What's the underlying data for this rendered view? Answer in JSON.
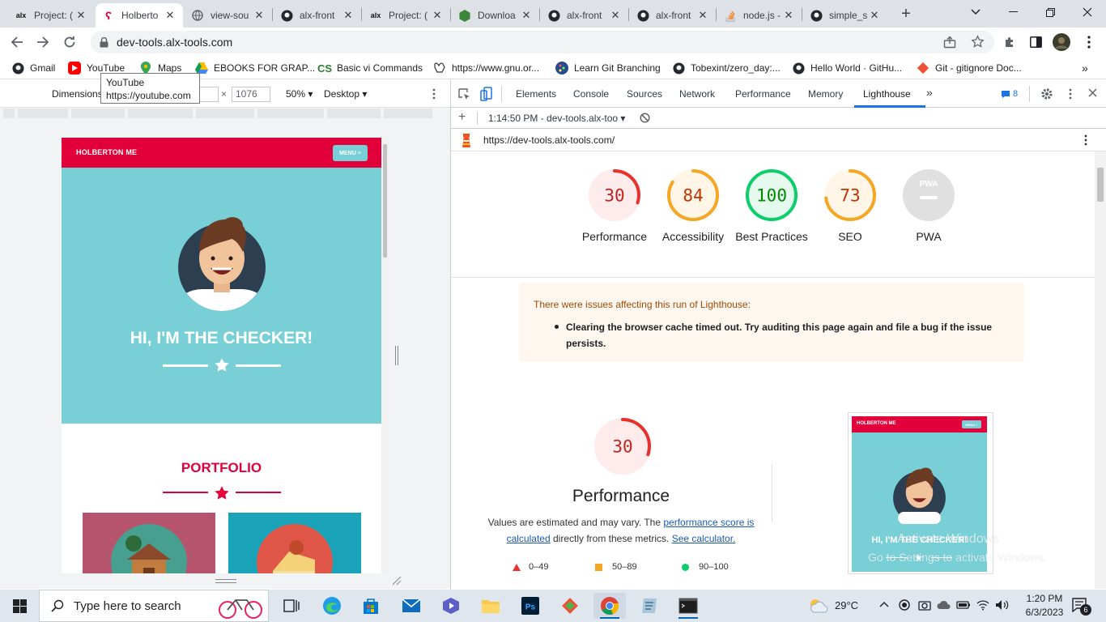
{
  "browser": {
    "tabs": [
      {
        "title": "Project: (",
        "favicon": "alx-icon",
        "active": false
      },
      {
        "title": "Holberto",
        "favicon": "holberton-icon",
        "active": true
      },
      {
        "title": "view-sou",
        "favicon": "globe-icon",
        "active": false
      },
      {
        "title": "alx-front",
        "favicon": "github-icon",
        "active": false
      },
      {
        "title": "Project: (",
        "favicon": "alx-icon",
        "active": false
      },
      {
        "title": "Downloa",
        "favicon": "nodejs-icon",
        "active": false
      },
      {
        "title": "alx-front",
        "favicon": "github-icon",
        "active": false
      },
      {
        "title": "alx-front",
        "favicon": "github-icon",
        "active": false
      },
      {
        "title": "node.js -",
        "favicon": "stackoverflow-icon",
        "active": false
      },
      {
        "title": "simple_s",
        "favicon": "github-icon",
        "active": false
      }
    ],
    "url": "dev-tools.alx-tools.com",
    "bookmarks": [
      {
        "label": "Gmail",
        "icon": "github-icon"
      },
      {
        "label": "YouTube",
        "icon": "youtube-icon"
      },
      {
        "label": "Maps",
        "icon": "maps-icon"
      },
      {
        "label": "EBOOKS FOR GRAP...",
        "icon": "drive-icon"
      },
      {
        "label": "Basic vi Commands",
        "icon": "cs-icon"
      },
      {
        "label": "https://www.gnu.or...",
        "icon": "gnu-icon"
      },
      {
        "label": "Learn Git Branching",
        "icon": "git-branch-icon"
      },
      {
        "label": "Tobexint/zero_day:...",
        "icon": "github-icon"
      },
      {
        "label": "Hello World · GitHu...",
        "icon": "github-icon"
      },
      {
        "label": "Git - gitignore Doc...",
        "icon": "git-icon"
      }
    ],
    "tooltip": {
      "title": "YouTube",
      "url": "https://youtube.com"
    }
  },
  "device_toolbar": {
    "dimensions_label": "Dimensions",
    "height_value": "1076",
    "times": "×",
    "zoom": "50%",
    "device": "Desktop"
  },
  "emulated_page": {
    "brand": "HOLBERTON ME",
    "menu_label": "MENU ≡",
    "hero_title": "HI, I'M THE CHECKER!",
    "portfolio_title": "PORTFOLIO"
  },
  "devtools": {
    "tabs": [
      "Elements",
      "Console",
      "Sources",
      "Network",
      "Performance",
      "Memory",
      "Lighthouse"
    ],
    "active_tab": "Lighthouse",
    "issues_count": "8",
    "report_time": "1:14:50 PM - dev-tools.alx-too",
    "report_url": "https://dev-tools.alx-tools.com/",
    "scores": [
      {
        "label": "Performance",
        "value": 30,
        "status": "fail"
      },
      {
        "label": "Accessibility",
        "value": 84,
        "status": "average"
      },
      {
        "label": "Best Practices",
        "value": 100,
        "status": "pass"
      },
      {
        "label": "SEO",
        "value": 73,
        "status": "average"
      },
      {
        "label": "PWA",
        "value": null,
        "status": "na"
      }
    ],
    "pwa_badge": "PWA",
    "warning": {
      "title": "There were issues affecting this run of Lighthouse:",
      "item": "Clearing the browser cache timed out. Try auditing this page again and file a bug if the issue persists."
    },
    "perf_section": {
      "score": "30",
      "title": "Performance",
      "desc_prefix": "Values are estimated and may vary. The ",
      "link1": "performance score is calculated",
      "desc_mid": " directly from these metrics. ",
      "link2": "See calculator."
    },
    "legend": [
      {
        "label": "0–49",
        "shape": "triangle",
        "color": "#e8302d"
      },
      {
        "label": "50–89",
        "shape": "square",
        "color": "#f5a623"
      },
      {
        "label": "90–100",
        "shape": "circle",
        "color": "#0cce6b"
      }
    ],
    "screenshot": {
      "brand": "HOLBERTON ME",
      "menu": "MENU ≡",
      "title": "HI, I'M THE CHECKER!"
    }
  },
  "watermark": {
    "line1": "Activate Windows",
    "line2": "Go to Settings to activate Windows."
  },
  "taskbar": {
    "search_placeholder": "Type here to search",
    "weather": "29°C",
    "time": "1:20 PM",
    "date": "6/3/2023",
    "notifications": "6"
  },
  "colors": {
    "fail": "#e8302d",
    "average": "#f5a623",
    "pass": "#0cce6b",
    "holberton_red": "#e2003b",
    "hero_teal": "#78cfd6"
  }
}
